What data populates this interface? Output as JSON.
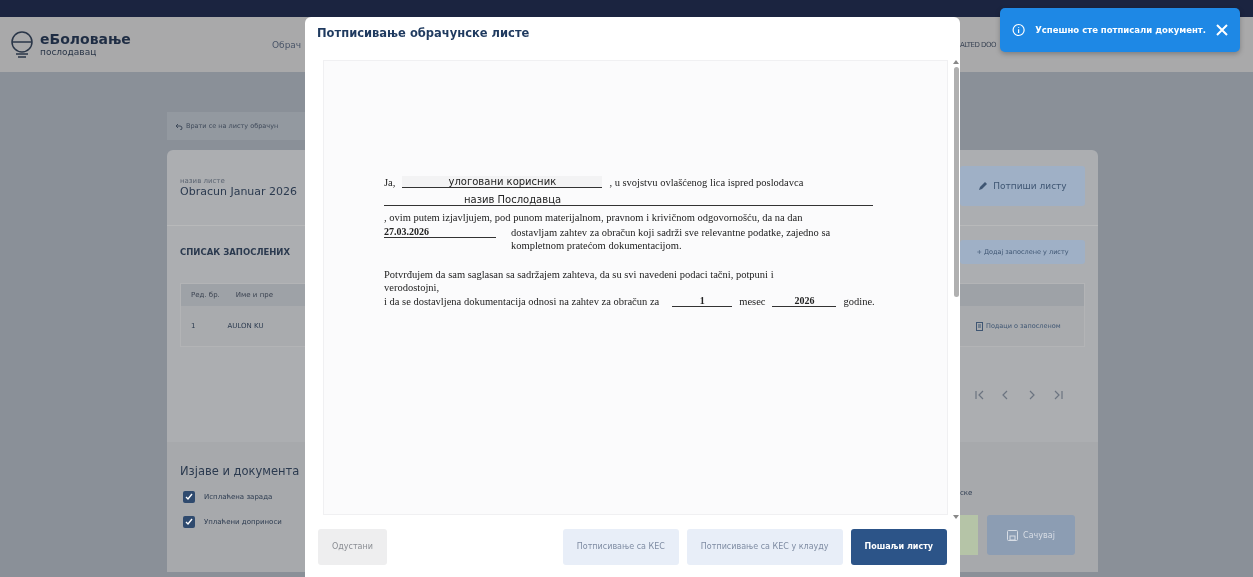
{
  "header": {
    "app_name": "еБоловање",
    "app_subtitle": "послодавац",
    "nav_item": "Обрач",
    "company": "ALTED DOO"
  },
  "back_link": "Врати се на листу обрачун",
  "list": {
    "name_label": "назив листе",
    "name": "Obracun Januar 2026",
    "sign_button": "Потпиши листу"
  },
  "employees": {
    "title": "СПИСАК ЗАПОСЛЕНИХ",
    "add_button": "+ Додај запослене у листу",
    "columns": [
      "Ред. бр.",
      "Име и пре"
    ],
    "rows": [
      {
        "number": "1",
        "name": "AULON KU",
        "action": "Подаци о запосленом"
      }
    ]
  },
  "statements": {
    "title": "Изјаве и документа",
    "items": [
      {
        "label": "Исплаћена зарада",
        "checked": true
      },
      {
        "label": "Уплаћени доприноси",
        "checked": true
      }
    ],
    "column_3": "ске",
    "save_button": "Сачувај"
  },
  "modal": {
    "title": "Потписивање обрачунске листе",
    "document": {
      "intro": "Ja,",
      "user": "улоговани корисник",
      "role_text": ", u svojstvu ovlašćenog lica ispred poslodavca",
      "employer": "назив Послодавца",
      "statement": ", ovim putem izjavljujem, pod punom materijalnom, pravnom i krivičnom odgovornošću, da na dan",
      "date": "27.03.2026",
      "request_text": "dostavljam zahtev za obračun koji sadrži sve relevantne podatke, zajedno sa kompletnom pratećom dokumentacijom.",
      "confirm_text": "Potvrđujem da sam saglasan sa sadržajem zahteva, da su svi navedeni podaci tačni, potpuni i verodostojni,",
      "period_text": "i da se dostavljena dokumentacija odnosi na zahtev za obračun za",
      "month": "1",
      "month_label": "mesec",
      "year": "2026",
      "year_label": "godine."
    },
    "buttons": [
      {
        "label": "Одустани",
        "kind": "plain",
        "disabled": true
      },
      {
        "label": "Потписивање са КЕС",
        "kind": "primary",
        "disabled": true
      },
      {
        "label": "Потписивање са КЕС у клауду",
        "kind": "primary",
        "disabled": true
      },
      {
        "label": "Пошаљи листу",
        "kind": "primary",
        "disabled": false
      }
    ]
  },
  "toast": {
    "message": "Успешно сте потписали документ."
  }
}
